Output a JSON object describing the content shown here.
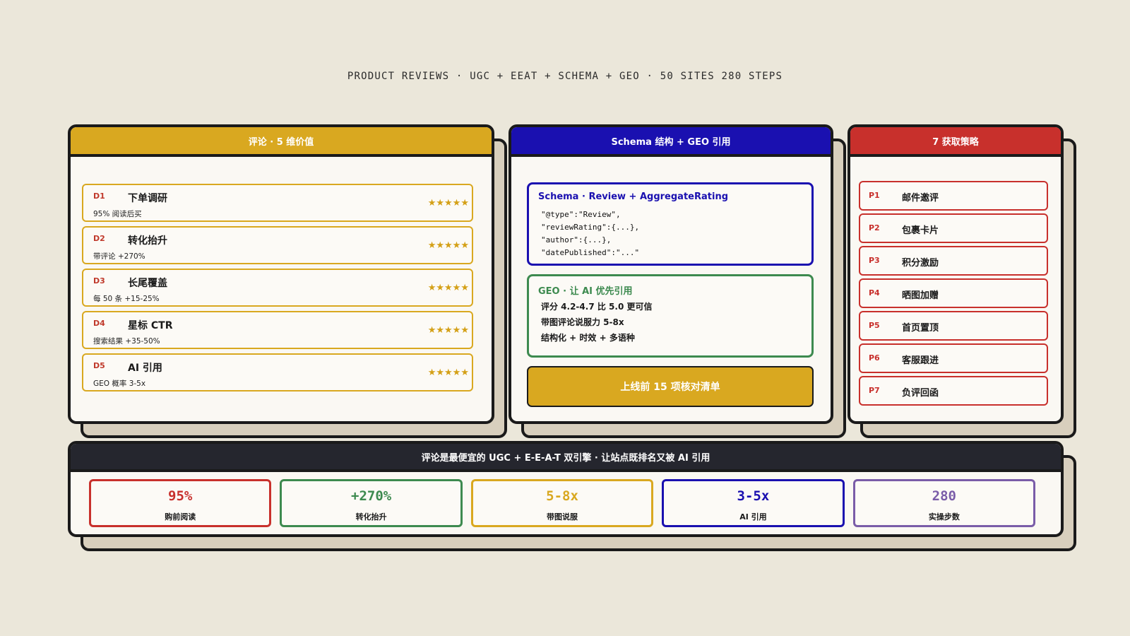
{
  "page_title": "PRODUCT REVIEWS · UGC + EEAT + SCHEMA + GEO · 50 SITES 280 STEPS",
  "colors": {
    "gold": "#d9a820",
    "blue": "#1a10b0",
    "red": "#c8302c",
    "green": "#3d8a4f",
    "purple": "#7a5ca8",
    "dark": "#25262e",
    "background": "#ebe7da"
  },
  "values_panel": {
    "title": "评论 · 5 维价值",
    "items": [
      {
        "code": "D1",
        "name": "下单调研",
        "desc": "95% 阅读后买",
        "stars": "★★★★★"
      },
      {
        "code": "D2",
        "name": "转化抬升",
        "desc": "带评论 +270%",
        "stars": "★★★★★"
      },
      {
        "code": "D3",
        "name": "长尾覆盖",
        "desc": "每 50 条 +15-25%",
        "stars": "★★★★★"
      },
      {
        "code": "D4",
        "name": "星标 CTR",
        "desc": "搜索结果 +35-50%",
        "stars": "★★★★★"
      },
      {
        "code": "D5",
        "name": "AI 引用",
        "desc": "GEO 概率 3-5x",
        "stars": "★★★★★"
      }
    ]
  },
  "schema_panel": {
    "title": "Schema 结构 + GEO 引用",
    "schema_box": {
      "title": "Schema · Review + AggregateRating",
      "code": "\"@type\":\"Review\",\n\"reviewRating\":{...},\n\"author\":{...},\n\"datePublished\":\"...\""
    },
    "geo_box": {
      "title": "GEO · 让 AI 优先引用",
      "lines": [
        "评分 4.2-4.7 比 5.0 更可信",
        "带图评论说服力 5-8x",
        "结构化 + 时效 + 多语种"
      ]
    },
    "checklist_button": "上线前 15 项核对清单"
  },
  "strategy_panel": {
    "title": "7 获取策略",
    "items": [
      {
        "code": "P1",
        "name": "邮件邀评"
      },
      {
        "code": "P2",
        "name": "包裹卡片"
      },
      {
        "code": "P3",
        "name": "积分激励"
      },
      {
        "code": "P4",
        "name": "晒图加赠"
      },
      {
        "code": "P5",
        "name": "首页置顶"
      },
      {
        "code": "P6",
        "name": "客服跟进"
      },
      {
        "code": "P7",
        "name": "负评回函"
      }
    ]
  },
  "summary_panel": {
    "title": "评论是最便宜的 UGC + E-E-A-T 双引擎 · 让站点既排名又被 AI 引用",
    "metrics": [
      {
        "value": "95%",
        "label": "购前阅读",
        "color": "#c8302c"
      },
      {
        "value": "+270%",
        "label": "转化抬升",
        "color": "#3d8a4f"
      },
      {
        "value": "5-8x",
        "label": "带图说服",
        "color": "#d9a820"
      },
      {
        "value": "3-5x",
        "label": "AI 引用",
        "color": "#1a10b0"
      },
      {
        "value": "280",
        "label": "实操步数",
        "color": "#7a5ca8"
      }
    ]
  }
}
